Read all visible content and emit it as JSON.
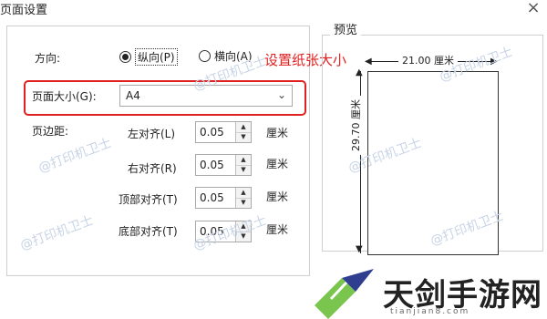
{
  "window": {
    "title": "页面设置",
    "close_glyph": "×"
  },
  "dialog": {
    "orientation": {
      "label": "方向:",
      "options": [
        {
          "label": "纵向(P)",
          "selected": true
        },
        {
          "label": "横向(A)",
          "selected": false
        }
      ]
    },
    "annotation": "设置纸张大小",
    "page_size": {
      "label": "页面大小(G):",
      "value": "A4"
    },
    "margins": {
      "label": "页边距:",
      "rows": [
        {
          "label": "左对齐(L)",
          "value": "0.05",
          "unit": "厘米"
        },
        {
          "label": "右对齐(R)",
          "value": "0.05",
          "unit": "厘米"
        },
        {
          "label": "顶部对齐(T)",
          "value": "0.05",
          "unit": "厘米"
        },
        {
          "label": "底部对齐(T)",
          "value": "0.05",
          "unit": "厘米"
        }
      ]
    }
  },
  "preview": {
    "title": "预览",
    "width_label": "21.00 厘米",
    "height_label": "29.70 厘米"
  },
  "watermark": "@打印机卫士",
  "site": {
    "name": "天剑手游网",
    "pinyin": "tianjian8.com"
  }
}
